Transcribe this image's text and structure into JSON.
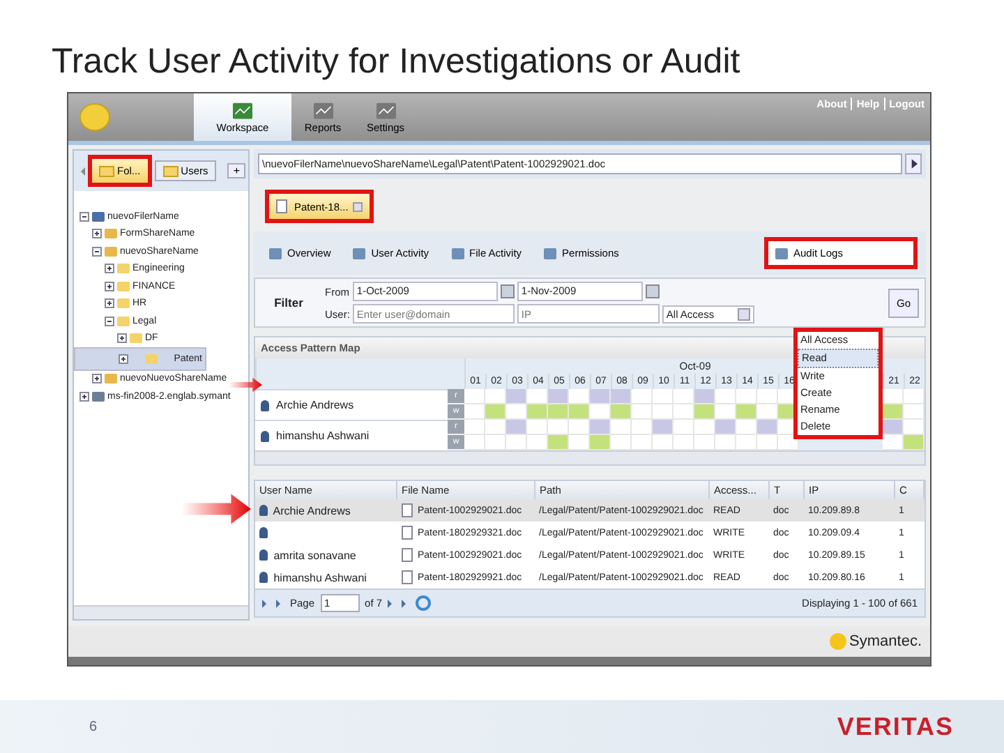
{
  "slide": {
    "title": "Track User Activity for Investigations or Audit",
    "page_number": "6",
    "brand": "VERITAS"
  },
  "app": {
    "nav": [
      {
        "label": "Workspace",
        "selected": true
      },
      {
        "label": "Reports",
        "selected": false
      },
      {
        "label": "Settings",
        "selected": false
      }
    ],
    "top_links": [
      "About",
      "Help",
      "Logout"
    ],
    "left_tabs": [
      {
        "label": "Fol...",
        "selected": true,
        "highlighted": true
      },
      {
        "label": "Users",
        "selected": false,
        "highlighted": false
      }
    ],
    "add_tab": "+",
    "tree": [
      {
        "label": "nuevoFilerName",
        "kind": "filer",
        "expanded": true,
        "selected": false,
        "children": [
          {
            "label": "FormShareName",
            "kind": "share",
            "expanded": false,
            "selected": false
          },
          {
            "label": "nuevoShareName",
            "kind": "share",
            "expanded": true,
            "selected": false,
            "children": [
              {
                "label": "Engineering",
                "kind": "folder",
                "expanded": false,
                "selected": false
              },
              {
                "label": "FINANCE",
                "kind": "folder",
                "expanded": false,
                "selected": false
              },
              {
                "label": "HR",
                "kind": "folder",
                "expanded": false,
                "selected": false
              },
              {
                "label": "Legal",
                "kind": "folder",
                "expanded": true,
                "selected": false,
                "children": [
                  {
                    "label": "DF",
                    "kind": "folder",
                    "expanded": false,
                    "selected": false
                  },
                  {
                    "label": "Patent",
                    "kind": "folder",
                    "expanded": false,
                    "selected": true
                  }
                ]
              }
            ]
          },
          {
            "label": "nuevoNuevoShareName",
            "kind": "share",
            "expanded": false,
            "selected": false
          }
        ]
      },
      {
        "label": "ms-fin2008-2.englab.symant",
        "kind": "server",
        "expanded": false,
        "selected": false
      }
    ],
    "path": "\\nuevoFilerName\\nuevoShareName\\Legal\\Patent\\Patent-1002929021.doc",
    "doc_tabs": [
      {
        "label": "Patent-18...",
        "selected": true,
        "highlighted": true
      }
    ],
    "sub_tabs": [
      {
        "label": "Overview",
        "selected": false,
        "highlighted": false
      },
      {
        "label": "User Activity",
        "selected": false,
        "highlighted": false
      },
      {
        "label": "File Activity",
        "selected": false,
        "highlighted": false
      },
      {
        "label": "Permissions",
        "selected": false,
        "highlighted": false
      },
      {
        "label": "Audit Logs",
        "selected": true,
        "highlighted": true
      }
    ],
    "filter": {
      "title": "Filter",
      "from_label": "From",
      "from": "1-Oct-2009",
      "to": "1-Nov-2009",
      "user_label": "User:",
      "user_placeholder": "Enter user@domain",
      "ip_placeholder": "IP",
      "access": "All Access",
      "go": "Go"
    },
    "access_menu": {
      "highlighted": true,
      "options": [
        {
          "label": "All Access",
          "selected": false
        },
        {
          "label": "Read",
          "selected": true
        },
        {
          "label": "Write",
          "selected": false
        },
        {
          "label": "Create",
          "selected": false
        },
        {
          "label": "Rename",
          "selected": false
        },
        {
          "label": "Delete",
          "selected": false
        }
      ]
    },
    "map": {
      "title": "Access Pattern Map",
      "month": "Oct-09",
      "days": [
        "01",
        "02",
        "03",
        "04",
        "05",
        "06",
        "07",
        "08",
        "09",
        "10",
        "11",
        "12",
        "13",
        "14",
        "15",
        "16"
      ],
      "days_after_menu": [
        "21",
        "22"
      ],
      "users": [
        {
          "name": "Archie Andrews",
          "lanes": [
            {
              "label": "r",
              "color": "#c8c8e6",
              "cells": [
                false,
                false,
                true,
                false,
                true,
                false,
                true,
                true,
                false,
                false,
                false,
                true,
                false,
                false,
                false,
                false,
                false,
                false
              ]
            },
            {
              "label": "w",
              "color": "#c4e27c",
              "cells": [
                false,
                true,
                false,
                true,
                true,
                true,
                false,
                true,
                false,
                false,
                false,
                true,
                false,
                true,
                false,
                true,
                true,
                false
              ]
            }
          ]
        },
        {
          "name": "himanshu Ashwani",
          "lanes": [
            {
              "label": "r",
              "color": "#c8c8e6",
              "cells": [
                false,
                false,
                true,
                false,
                false,
                false,
                true,
                false,
                false,
                true,
                false,
                false,
                true,
                false,
                true,
                false,
                true,
                false
              ]
            },
            {
              "label": "w",
              "color": "#c4e27c",
              "cells": [
                false,
                false,
                false,
                false,
                true,
                false,
                true,
                false,
                false,
                false,
                false,
                false,
                false,
                false,
                false,
                false,
                false,
                true
              ]
            }
          ]
        }
      ]
    },
    "log": {
      "columns": [
        "User Name",
        "File Name",
        "Path",
        "Access...",
        "T",
        "IP",
        "C"
      ],
      "rows": [
        {
          "selected": true,
          "cells": [
            "Archie Andrews",
            "Patent-1002929021.doc",
            "/Legal/Patent/Patent-1002929021.doc",
            "READ",
            "doc",
            "10.209.89.8",
            "1"
          ]
        },
        {
          "selected": false,
          "cells": [
            "",
            "Patent-1802929321.doc",
            "/Legal/Patent/Patent-1002929021.doc",
            "WRITE",
            "doc",
            "10.209.09.4",
            "1"
          ]
        },
        {
          "selected": false,
          "cells": [
            "amrita sonavane",
            "Patent-1002929021.doc",
            "/Legal/Patent/Patent-1002929021.doc",
            "WRITE",
            "doc",
            "10.209.89.15",
            "1"
          ]
        },
        {
          "selected": false,
          "cells": [
            "himanshu Ashwani",
            "Patent-1802929921.doc",
            "/Legal/Patent/Patent-1002929021.doc",
            "READ",
            "doc",
            "10.209.80.16",
            "1"
          ]
        }
      ]
    },
    "pager": {
      "page_label": "Page",
      "page": "1",
      "of": "of 7",
      "display": "Displaying 1 - 100 of 661"
    },
    "vendor": "Symantec."
  }
}
